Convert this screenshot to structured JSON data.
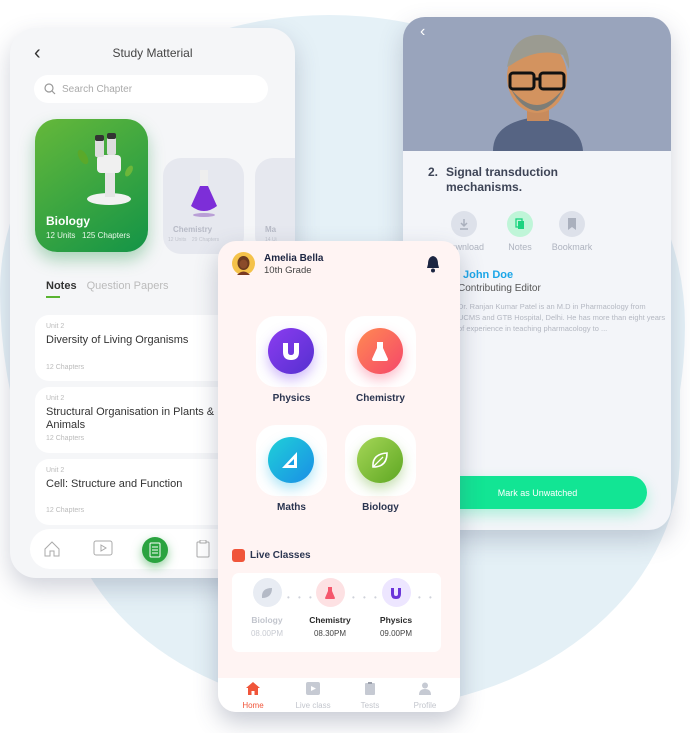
{
  "study_material": {
    "title": "Study Matterial",
    "search_placeholder": "Search Chapter",
    "subjects": [
      {
        "name": "Biology",
        "units": "12 Units",
        "chapters": "125 Chapters"
      },
      {
        "name": "Chemistry",
        "units": "12 Units",
        "chapters": "29 Chapters"
      },
      {
        "name": "Ma",
        "units": "14 Ui",
        "chapters": ""
      }
    ],
    "tabs": [
      "Notes",
      "Question Papers"
    ],
    "units": [
      {
        "unit": "Unit 2",
        "name": "Diversity of Living Organisms",
        "chapters": "12 Chapters"
      },
      {
        "unit": "Unit 2",
        "name": "Structural Organisation in Plants & Animals",
        "chapters": "12 Chapters"
      },
      {
        "unit": "Unit 2",
        "name": "Cell: Structure and Function",
        "chapters": "12 Chapters"
      }
    ],
    "nav_icons": [
      "home-icon",
      "video-icon",
      "notes-icon",
      "clipboard-icon"
    ]
  },
  "home": {
    "user_name": "Amelia Bella",
    "grade": "10th Grade",
    "subjects": [
      "Physics",
      "Chemistry",
      "Maths",
      "Biology"
    ],
    "live_classes_title": "Live Classes",
    "live_classes": [
      {
        "subject": "Biology",
        "time": "08.00PM",
        "active": false
      },
      {
        "subject": "Chemistry",
        "time": "08.30PM",
        "active": true
      },
      {
        "subject": "Physics",
        "time": "09.00PM",
        "active": true
      }
    ],
    "nav": [
      {
        "label": "Home",
        "active": true
      },
      {
        "label": "Live class",
        "active": false
      },
      {
        "label": "Tests",
        "active": false
      },
      {
        "label": "Profile",
        "active": false
      }
    ],
    "colors": {
      "accent": "#f0553a",
      "physics": "#6a35d9",
      "chemistry": "#f8586e",
      "maths": "#1a9fe6",
      "biology": "#6ab22e"
    }
  },
  "lecture": {
    "number": "2.",
    "title": "Signal transduction mechanisms.",
    "actions": [
      "Download",
      "Notes",
      "Bookmark"
    ],
    "author": "John Doe",
    "author_prefix": "Dr.",
    "role": "Contributing Editor",
    "bio": "Dr. Ranjan Kumar Patel is an M.D in Pharmacology from UCMS and GTB Hospital, Delhi. He has more than eight years of experience in teaching pharmacology to ...",
    "button": "Mark as Unwatched",
    "colors": {
      "button": "#12e594",
      "author": "#1ba6e8"
    }
  }
}
